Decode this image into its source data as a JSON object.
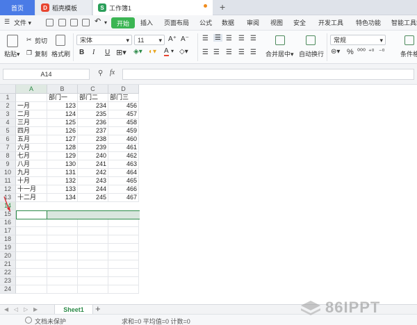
{
  "tabs": {
    "home": "首页",
    "template": "稻壳模板",
    "workbook": "工作簿1",
    "template_icon": "D",
    "workbook_icon": "S"
  },
  "menu": {
    "file": "文件",
    "start": "开始",
    "items": [
      "插入",
      "页面布局",
      "公式",
      "数据",
      "审阅",
      "视图",
      "安全",
      "开发工具",
      "特色功能",
      "智能工具箱"
    ]
  },
  "ribbon": {
    "paste": "粘贴",
    "cut": "剪切",
    "copy": "复制",
    "format_painter": "格式刷",
    "font_name": "宋体",
    "font_size": "11",
    "merge_center": "合并居中",
    "wrap_text": "自动换行",
    "number_format": "常规",
    "conditional_format": "条件格",
    "bold": "B",
    "italic": "I",
    "underline": "U",
    "font_color_glyph": "A",
    "percent": "%",
    "grow_font": "A⁺",
    "shrink_font": "A⁻"
  },
  "formula_bar": {
    "cell_ref": "A14",
    "fx": "fx",
    "value": ""
  },
  "grid": {
    "columns": [
      "A",
      "B",
      "C",
      "D"
    ],
    "row_numbers": [
      "1",
      "2",
      "3",
      "4",
      "5",
      "6",
      "7",
      "8",
      "9",
      "10",
      "11",
      "12",
      "13",
      "14",
      "15",
      "16",
      "17",
      "18",
      "19",
      "20",
      "21",
      "22",
      "23",
      "24"
    ],
    "active_row": "14",
    "active_col": "A",
    "header_row": [
      "",
      "部门一",
      "部门二",
      "部门三"
    ],
    "rows": [
      [
        "一月",
        "123",
        "234",
        "456"
      ],
      [
        "二月",
        "124",
        "235",
        "457"
      ],
      [
        "三月",
        "125",
        "236",
        "458"
      ],
      [
        "四月",
        "126",
        "237",
        "459"
      ],
      [
        "五月",
        "127",
        "238",
        "460"
      ],
      [
        "六月",
        "128",
        "239",
        "461"
      ],
      [
        "七月",
        "129",
        "240",
        "462"
      ],
      [
        "八月",
        "130",
        "241",
        "463"
      ],
      [
        "九月",
        "131",
        "242",
        "464"
      ],
      [
        "十月",
        "132",
        "243",
        "465"
      ],
      [
        "十一月",
        "133",
        "244",
        "466"
      ],
      [
        "十二月",
        "134",
        "245",
        "467"
      ]
    ]
  },
  "sheets": {
    "active": "Sheet1",
    "add": "+"
  },
  "status": {
    "protect": "文档未保护",
    "stats": "求和=0  平均值=0  计数=0"
  },
  "watermark": "86IPPT",
  "colors": {
    "accent_green": "#2b8a48",
    "start_green": "#3bb553",
    "home_tab_blue": "#4a7be6"
  }
}
